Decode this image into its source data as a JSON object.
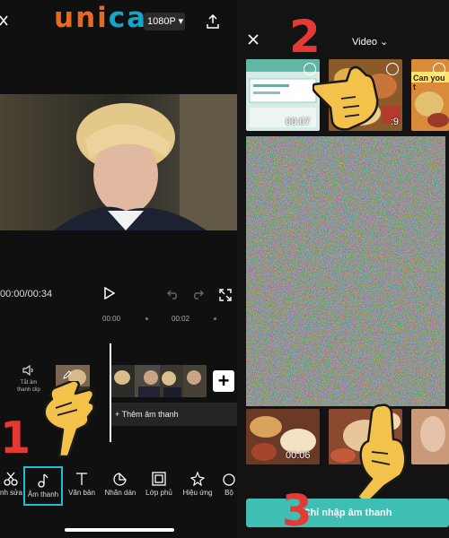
{
  "branding": {
    "logo_part1": "uni",
    "logo_part2": "ca"
  },
  "left": {
    "resolution": "1080P",
    "timecode": "00:00/00:34",
    "ruler": {
      "t0": "00:00",
      "t2": "00:02"
    },
    "mute_label_line1": "Tắt âm",
    "mute_label_line2": "thanh clip",
    "add_audio_label": "+ Thêm âm thanh",
    "add_clip_label": "+",
    "step1": "1",
    "tools": [
      {
        "label": "nh sửa",
        "icon": "scissors-icon"
      },
      {
        "label": "Âm thanh",
        "icon": "music-note-icon"
      },
      {
        "label": "Văn bản",
        "icon": "text-icon"
      },
      {
        "label": "Nhãn dán",
        "icon": "sticker-icon"
      },
      {
        "label": "Lớp phủ",
        "icon": "overlay-icon"
      },
      {
        "label": "Hiệu ứng",
        "icon": "effects-icon"
      },
      {
        "label": "Bộ",
        "icon": "filter-icon"
      }
    ]
  },
  "right": {
    "album_label": "Video",
    "step2": "2",
    "step3": "3",
    "thumbs_top": [
      {
        "duration": "00:07"
      },
      {
        "duration": ":9"
      },
      {
        "duration": ""
      }
    ],
    "thumb3_caption": "Can you t",
    "bottom_duration": "00:06",
    "import_label": "Chỉ nhập âm thanh",
    "accent": "#3fbfb4",
    "step_color": "#e53935"
  }
}
